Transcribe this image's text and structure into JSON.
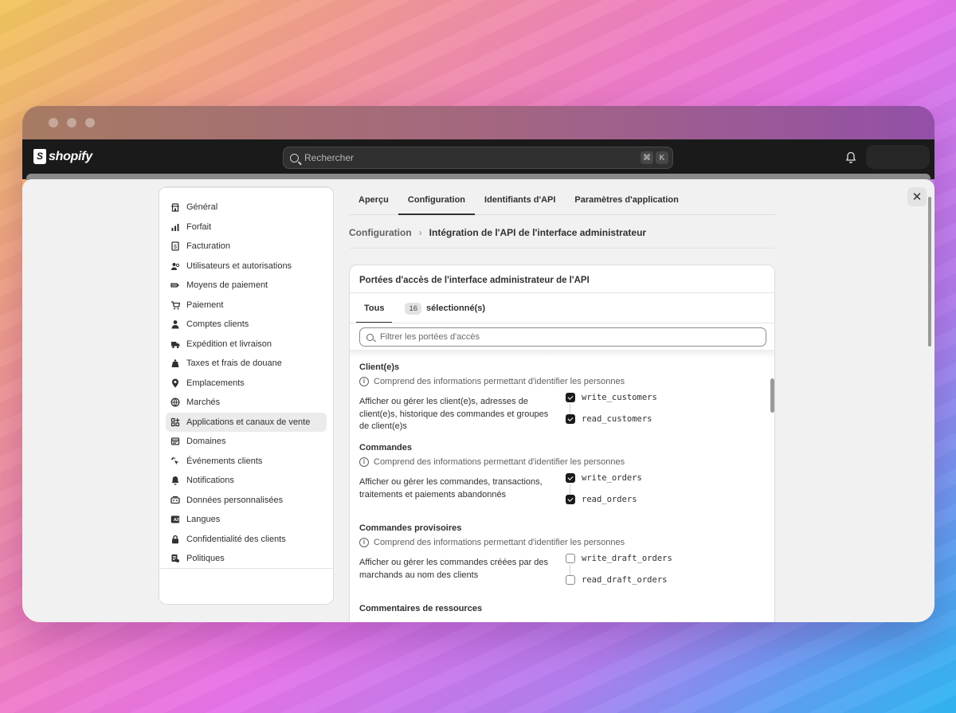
{
  "window": {
    "dots": 3
  },
  "topbar": {
    "logo_text": "shopify",
    "search_placeholder": "Rechercher",
    "shortcut_cmd": "⌘",
    "shortcut_key": "K"
  },
  "sidebar": {
    "items": [
      {
        "label": "Général",
        "icon": "store-icon"
      },
      {
        "label": "Forfait",
        "icon": "plan-icon"
      },
      {
        "label": "Facturation",
        "icon": "billing-icon"
      },
      {
        "label": "Utilisateurs et autorisations",
        "icon": "users-icon"
      },
      {
        "label": "Moyens de paiement",
        "icon": "payment-icon"
      },
      {
        "label": "Paiement",
        "icon": "cart-icon"
      },
      {
        "label": "Comptes clients",
        "icon": "person-icon"
      },
      {
        "label": "Expédition et livraison",
        "icon": "truck-icon"
      },
      {
        "label": "Taxes et frais de douane",
        "icon": "tax-icon"
      },
      {
        "label": "Emplacements",
        "icon": "location-icon"
      },
      {
        "label": "Marchés",
        "icon": "globe-icon"
      },
      {
        "label": "Applications et canaux de vente",
        "icon": "apps-icon",
        "active": true
      },
      {
        "label": "Domaines",
        "icon": "domain-icon"
      },
      {
        "label": "Événements clients",
        "icon": "cursor-icon"
      },
      {
        "label": "Notifications",
        "icon": "bell-icon"
      },
      {
        "label": "Données personnalisées",
        "icon": "data-icon"
      },
      {
        "label": "Langues",
        "icon": "language-icon"
      },
      {
        "label": "Confidentialité des clients",
        "icon": "lock-icon"
      },
      {
        "label": "Politiques",
        "icon": "policy-icon"
      }
    ]
  },
  "tabs": [
    "Aperçu",
    "Configuration",
    "Identifiants d'API",
    "Paramètres d'application"
  ],
  "active_tab": "Configuration",
  "breadcrumb": {
    "parent": "Configuration",
    "separator": "›",
    "current": "Intégration de l'API de l'interface administrateur"
  },
  "card": {
    "title": "Portées d'accès de l'interface administrateur de l'API",
    "tab_all": "Tous",
    "selected_count": "16",
    "selected_label": "sélectionné(s)",
    "filter_placeholder": "Filtrer les portées d'accès"
  },
  "scope_groups": [
    {
      "title": "Client(e)s",
      "info": "Comprend des informations permettant d'identifier les personnes",
      "description": "Afficher ou gérer les client(e)s, adresses de client(e)s, historique des commandes et groupes de client(e)s",
      "write": {
        "label": "write_customers",
        "checked": true
      },
      "read": {
        "label": "read_customers",
        "checked": true
      }
    },
    {
      "title": "Commandes",
      "info": "Comprend des informations permettant d'identifier les personnes",
      "description": "Afficher ou gérer les commandes, transactions, traitements et paiements abandonnés",
      "write": {
        "label": "write_orders",
        "checked": true
      },
      "read": {
        "label": "read_orders",
        "checked": true
      }
    },
    {
      "title": "Commandes provisoires",
      "info": "Comprend des informations permettant d'identifier les personnes",
      "description": "Afficher ou gérer les commandes créées par des marchands au nom des clients",
      "write": {
        "label": "write_draft_orders",
        "checked": false
      },
      "read": {
        "label": "read_draft_orders",
        "checked": false
      }
    },
    {
      "title": "Commentaires de ressources"
    }
  ]
}
